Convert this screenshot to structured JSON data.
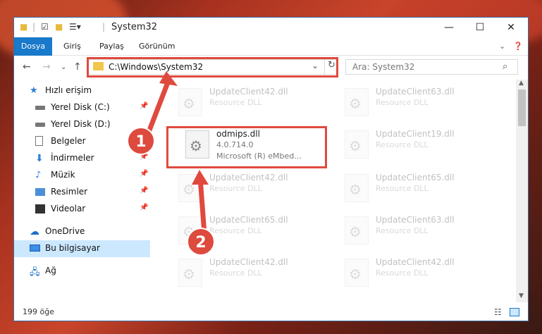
{
  "titlebar": {
    "title": "System32",
    "minimize": "—",
    "maximize": "☐",
    "close": "✕"
  },
  "ribbon": {
    "tabs": [
      "Dosya",
      "Giriş",
      "Paylaş",
      "Görünüm"
    ]
  },
  "addressbar": {
    "path": "C:\\Windows\\System32",
    "search_placeholder": "Ara: System32"
  },
  "sidebar": {
    "items": [
      {
        "label": "Hızlı erişim",
        "icon": "star-icon"
      },
      {
        "label": "Yerel Disk (C:)",
        "icon": "drive-icon",
        "pinned": true
      },
      {
        "label": "Yerel Disk (D:)",
        "icon": "drive-icon"
      },
      {
        "label": "Belgeler",
        "icon": "document-icon",
        "pinned": true
      },
      {
        "label": "İndirmeler",
        "icon": "download-icon",
        "pinned": true
      },
      {
        "label": "Müzik",
        "icon": "music-icon",
        "pinned": true
      },
      {
        "label": "Resimler",
        "icon": "pictures-icon",
        "pinned": true
      },
      {
        "label": "Videolar",
        "icon": "video-icon",
        "pinned": true
      },
      {
        "label": "OneDrive",
        "icon": "cloud-icon"
      },
      {
        "label": "Bu bilgisayar",
        "icon": "computer-icon",
        "selected": true
      },
      {
        "label": "Ağ",
        "icon": "network-icon"
      }
    ]
  },
  "files": [
    {
      "name": "UpdateClient42.dll",
      "line2": "Resource DLL",
      "line3": "",
      "faded": true
    },
    {
      "name": "UpdateClient63.dll",
      "line2": "Resource DLL",
      "line3": "",
      "faded": true
    },
    {
      "name": "odmips.dll",
      "line2": "4.0.714.0",
      "line3": "Microsoft (R) eMbed...",
      "faded": false
    },
    {
      "name": "UpdateClient19.dll",
      "line2": "Resource DLL",
      "line3": "",
      "faded": true
    },
    {
      "name": "UpdateClient42.dll",
      "line2": "Resource DLL",
      "line3": "",
      "faded": true
    },
    {
      "name": "UpdateClient65.dll",
      "line2": "Resource DLL",
      "line3": "",
      "faded": true
    },
    {
      "name": "UpdateClient65.dll",
      "line2": "Resource DLL",
      "line3": "",
      "faded": true
    },
    {
      "name": "UpdateClient63.dll",
      "line2": "Resource DLL",
      "line3": "",
      "faded": true
    },
    {
      "name": "UpdateClient42.dll",
      "line2": "Resource DLL",
      "line3": "",
      "faded": true
    },
    {
      "name": "UpdateClient42.dll",
      "line2": "Resource DLL",
      "line3": "",
      "faded": true
    }
  ],
  "status": {
    "count": "199 öğe"
  },
  "callouts": {
    "one": "1",
    "two": "2"
  },
  "colors": {
    "accent": "#1979ca",
    "highlight": "#e04a3e",
    "selection": "#cce8ff"
  }
}
